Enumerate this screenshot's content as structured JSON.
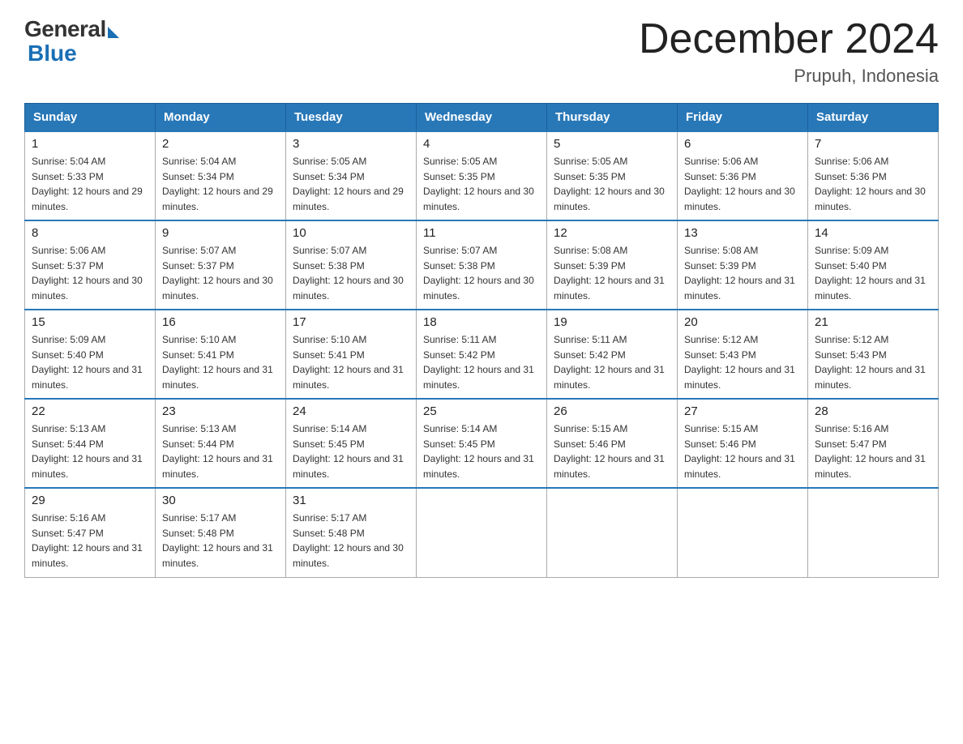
{
  "logo": {
    "general": "General",
    "blue": "Blue"
  },
  "header": {
    "month": "December 2024",
    "location": "Prupuh, Indonesia"
  },
  "days_of_week": [
    "Sunday",
    "Monday",
    "Tuesday",
    "Wednesday",
    "Thursday",
    "Friday",
    "Saturday"
  ],
  "weeks": [
    [
      {
        "day": "1",
        "sunrise": "5:04 AM",
        "sunset": "5:33 PM",
        "daylight": "12 hours and 29 minutes."
      },
      {
        "day": "2",
        "sunrise": "5:04 AM",
        "sunset": "5:34 PM",
        "daylight": "12 hours and 29 minutes."
      },
      {
        "day": "3",
        "sunrise": "5:05 AM",
        "sunset": "5:34 PM",
        "daylight": "12 hours and 29 minutes."
      },
      {
        "day": "4",
        "sunrise": "5:05 AM",
        "sunset": "5:35 PM",
        "daylight": "12 hours and 30 minutes."
      },
      {
        "day": "5",
        "sunrise": "5:05 AM",
        "sunset": "5:35 PM",
        "daylight": "12 hours and 30 minutes."
      },
      {
        "day": "6",
        "sunrise": "5:06 AM",
        "sunset": "5:36 PM",
        "daylight": "12 hours and 30 minutes."
      },
      {
        "day": "7",
        "sunrise": "5:06 AM",
        "sunset": "5:36 PM",
        "daylight": "12 hours and 30 minutes."
      }
    ],
    [
      {
        "day": "8",
        "sunrise": "5:06 AM",
        "sunset": "5:37 PM",
        "daylight": "12 hours and 30 minutes."
      },
      {
        "day": "9",
        "sunrise": "5:07 AM",
        "sunset": "5:37 PM",
        "daylight": "12 hours and 30 minutes."
      },
      {
        "day": "10",
        "sunrise": "5:07 AM",
        "sunset": "5:38 PM",
        "daylight": "12 hours and 30 minutes."
      },
      {
        "day": "11",
        "sunrise": "5:07 AM",
        "sunset": "5:38 PM",
        "daylight": "12 hours and 30 minutes."
      },
      {
        "day": "12",
        "sunrise": "5:08 AM",
        "sunset": "5:39 PM",
        "daylight": "12 hours and 31 minutes."
      },
      {
        "day": "13",
        "sunrise": "5:08 AM",
        "sunset": "5:39 PM",
        "daylight": "12 hours and 31 minutes."
      },
      {
        "day": "14",
        "sunrise": "5:09 AM",
        "sunset": "5:40 PM",
        "daylight": "12 hours and 31 minutes."
      }
    ],
    [
      {
        "day": "15",
        "sunrise": "5:09 AM",
        "sunset": "5:40 PM",
        "daylight": "12 hours and 31 minutes."
      },
      {
        "day": "16",
        "sunrise": "5:10 AM",
        "sunset": "5:41 PM",
        "daylight": "12 hours and 31 minutes."
      },
      {
        "day": "17",
        "sunrise": "5:10 AM",
        "sunset": "5:41 PM",
        "daylight": "12 hours and 31 minutes."
      },
      {
        "day": "18",
        "sunrise": "5:11 AM",
        "sunset": "5:42 PM",
        "daylight": "12 hours and 31 minutes."
      },
      {
        "day": "19",
        "sunrise": "5:11 AM",
        "sunset": "5:42 PM",
        "daylight": "12 hours and 31 minutes."
      },
      {
        "day": "20",
        "sunrise": "5:12 AM",
        "sunset": "5:43 PM",
        "daylight": "12 hours and 31 minutes."
      },
      {
        "day": "21",
        "sunrise": "5:12 AM",
        "sunset": "5:43 PM",
        "daylight": "12 hours and 31 minutes."
      }
    ],
    [
      {
        "day": "22",
        "sunrise": "5:13 AM",
        "sunset": "5:44 PM",
        "daylight": "12 hours and 31 minutes."
      },
      {
        "day": "23",
        "sunrise": "5:13 AM",
        "sunset": "5:44 PM",
        "daylight": "12 hours and 31 minutes."
      },
      {
        "day": "24",
        "sunrise": "5:14 AM",
        "sunset": "5:45 PM",
        "daylight": "12 hours and 31 minutes."
      },
      {
        "day": "25",
        "sunrise": "5:14 AM",
        "sunset": "5:45 PM",
        "daylight": "12 hours and 31 minutes."
      },
      {
        "day": "26",
        "sunrise": "5:15 AM",
        "sunset": "5:46 PM",
        "daylight": "12 hours and 31 minutes."
      },
      {
        "day": "27",
        "sunrise": "5:15 AM",
        "sunset": "5:46 PM",
        "daylight": "12 hours and 31 minutes."
      },
      {
        "day": "28",
        "sunrise": "5:16 AM",
        "sunset": "5:47 PM",
        "daylight": "12 hours and 31 minutes."
      }
    ],
    [
      {
        "day": "29",
        "sunrise": "5:16 AM",
        "sunset": "5:47 PM",
        "daylight": "12 hours and 31 minutes."
      },
      {
        "day": "30",
        "sunrise": "5:17 AM",
        "sunset": "5:48 PM",
        "daylight": "12 hours and 31 minutes."
      },
      {
        "day": "31",
        "sunrise": "5:17 AM",
        "sunset": "5:48 PM",
        "daylight": "12 hours and 30 minutes."
      },
      null,
      null,
      null,
      null
    ]
  ]
}
